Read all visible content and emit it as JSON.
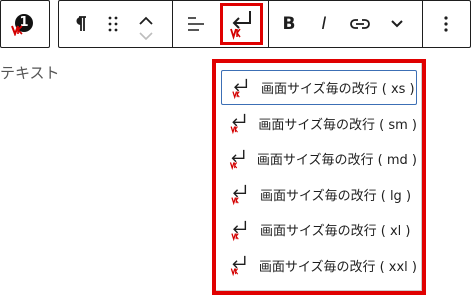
{
  "toolbar": {
    "block_badge": "1",
    "bold_label": "B",
    "italic_label": "I"
  },
  "editor": {
    "paragraph_text": "テキスト"
  },
  "dropdown": {
    "items": [
      {
        "label": "画面サイズ毎の改行 ( xs )",
        "focused": true
      },
      {
        "label": "画面サイズ毎の改行 ( sm )",
        "focused": false
      },
      {
        "label": "画面サイズ毎の改行 ( md )",
        "focused": false
      },
      {
        "label": "画面サイズ毎の改行 ( lg )",
        "focused": false
      },
      {
        "label": "画面サイズ毎の改行 ( xl )",
        "focused": false
      },
      {
        "label": "画面サイズ毎の改行 ( xxl )",
        "focused": false
      }
    ]
  },
  "colors": {
    "highlight_red": "#e00000",
    "focus_blue": "#3c6fb5",
    "icon_dark": "#1e1e1e"
  },
  "icons": [
    "vk-brand-icon",
    "paragraph-icon",
    "drag-handle-icon",
    "move-up-icon",
    "move-down-icon",
    "align-icon",
    "line-break-icon",
    "bold-icon",
    "italic-icon",
    "link-icon",
    "chevron-down-icon",
    "more-options-icon"
  ]
}
